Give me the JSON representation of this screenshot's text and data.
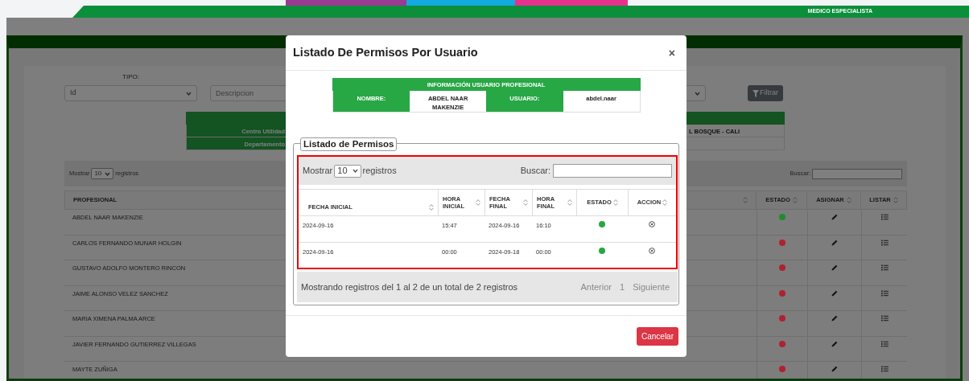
{
  "top_bar": {
    "role": "MEDICO ESPECIALISTA"
  },
  "filters": {
    "tipo_label": "TIPO:",
    "tipo_value": "Id",
    "descripcion_placeholder": "Descripcion",
    "button": "Filtrar"
  },
  "info_panel": {
    "rows": [
      {
        "label": "Centro Utilidad",
        "value": "L BOSQUE - CALI"
      },
      {
        "label": "Departamento"
      }
    ]
  },
  "list": {
    "show_prefix": "Mostrar",
    "page_size": "10",
    "show_suffix": "registros",
    "search_label": "Buscar:",
    "columns": [
      "PROFESIONAL",
      "ESTADO",
      "ASIGNAR",
      "LISTAR"
    ],
    "rows": [
      {
        "profesional": "ABDEL NAAR MAKENZIE",
        "color": "#1e8c2e"
      },
      {
        "profesional": "CARLOS FERNANDO MUNAR HOLGIN",
        "color": "#b0212f"
      },
      {
        "profesional": "GUSTAVO ADOLFO MONTERO RINCON",
        "color": "#b0212f"
      },
      {
        "profesional": "JAIME ALONSO VELEZ SANCHEZ",
        "color": "#b0212f"
      },
      {
        "profesional": "MARIA XIMENA PALMA ARCE",
        "color": "#b0212f"
      },
      {
        "profesional": "JAVIER FERNANDO GUTIERREZ VILLEGAS",
        "color": "#b0212f"
      },
      {
        "profesional": "MAYTE ZUÑIGA",
        "color": "#b0212f"
      }
    ]
  },
  "modal": {
    "title": "Listado De Permisos Por Usuario",
    "close": "×",
    "user_info": {
      "heading": "INFORMACIÓN USUARIO PROFESIONAL",
      "fields": [
        {
          "label": "NOMBRE:",
          "value": "ABDEL NAAR MAKENZIE"
        },
        {
          "label": "USUARIO:",
          "value": "abdel.naar"
        }
      ]
    },
    "permissions": {
      "legend": "Listado de Permisos",
      "show_prefix": "Mostrar",
      "page_size": "10",
      "show_suffix": "registros",
      "search_label": "Buscar:",
      "columns": [
        "FECHA INICIAL",
        "HORA INICIAL",
        "FECHA FINAL",
        "HORA FINAL",
        "ESTADO",
        "ACCION"
      ],
      "rows": [
        {
          "cells": [
            "2024-09-16",
            "15:47",
            "2024-09-16",
            "16:10"
          ],
          "color": "#28a745"
        },
        {
          "cells": [
            "2024-09-16",
            "00:00",
            "2024-09-18",
            "00:00"
          ],
          "color": "#28a745"
        }
      ],
      "info": "Mostrando registros del 1 al 2 de un total de 2 registros",
      "pagination": [
        {
          "label": "Anterior",
          "disabled": true
        },
        {
          "label": "1",
          "disabled": true
        },
        {
          "label": "Siguiente",
          "disabled": true
        }
      ]
    },
    "cancel": "Cancelar"
  }
}
